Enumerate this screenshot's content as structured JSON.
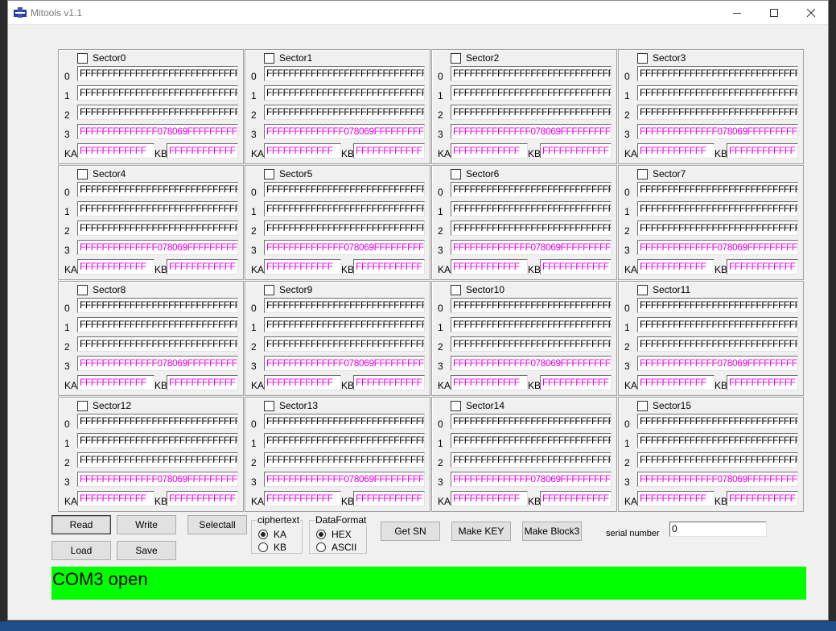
{
  "window": {
    "title": "Mitools v1.1",
    "accent_color": "#3f51b5"
  },
  "labels": {
    "block_rows": [
      "0",
      "1",
      "2",
      "3"
    ],
    "key_a": "KA",
    "key_b": "KB"
  },
  "sectors": [
    {
      "name": "Sector0",
      "checked": false,
      "blocks": [
        "FFFFFFFFFFFFFFFFFFFFFFFFFFFFFFFF",
        "FFFFFFFFFFFFFFFFFFFFFFFFFFFFFFFF",
        "FFFFFFFFFFFFFFFFFFFFFFFFFFFFFFFF",
        "FFFFFFFFFFFFFF078069FFFFFFFFFFFF"
      ],
      "key_a": "FFFFFFFFFFFF",
      "key_b": "FFFFFFFFFFFF"
    },
    {
      "name": "Sector1",
      "checked": false,
      "blocks": [
        "FFFFFFFFFFFFFFFFFFFFFFFFFFFFFFFF",
        "FFFFFFFFFFFFFFFFFFFFFFFFFFFFFFFF",
        "FFFFFFFFFFFFFFFFFFFFFFFFFFFFFFFF",
        "FFFFFFFFFFFFFF078069FFFFFFFFFFFF"
      ],
      "key_a": "FFFFFFFFFFFF",
      "key_b": "FFFFFFFFFFFF"
    },
    {
      "name": "Sector2",
      "checked": false,
      "blocks": [
        "FFFFFFFFFFFFFFFFFFFFFFFFFFFFFFFF",
        "FFFFFFFFFFFFFFFFFFFFFFFFFFFFFFFF",
        "FFFFFFFFFFFFFFFFFFFFFFFFFFFFFFFF",
        "FFFFFFFFFFFFFF078069FFFFFFFFFFFF"
      ],
      "key_a": "FFFFFFFFFFFF",
      "key_b": "FFFFFFFFFFFF"
    },
    {
      "name": "Sector3",
      "checked": false,
      "blocks": [
        "FFFFFFFFFFFFFFFFFFFFFFFFFFFFFFFF",
        "FFFFFFFFFFFFFFFFFFFFFFFFFFFFFFFF",
        "FFFFFFFFFFFFFFFFFFFFFFFFFFFFFFFF",
        "FFFFFFFFFFFFFF078069FFFFFFFFFFFF"
      ],
      "key_a": "FFFFFFFFFFFF",
      "key_b": "FFFFFFFFFFFF"
    },
    {
      "name": "Sector4",
      "checked": false,
      "blocks": [
        "FFFFFFFFFFFFFFFFFFFFFFFFFFFFFFFF",
        "FFFFFFFFFFFFFFFFFFFFFFFFFFFFFFFF",
        "FFFFFFFFFFFFFFFFFFFFFFFFFFFFFFFF",
        "FFFFFFFFFFFFFF078069FFFFFFFFFFFF"
      ],
      "key_a": "FFFFFFFFFFFF",
      "key_b": "FFFFFFFFFFFF"
    },
    {
      "name": "Sector5",
      "checked": false,
      "blocks": [
        "FFFFFFFFFFFFFFFFFFFFFFFFFFFFFFFF",
        "FFFFFFFFFFFFFFFFFFFFFFFFFFFFFFFF",
        "FFFFFFFFFFFFFFFFFFFFFFFFFFFFFFFF",
        "FFFFFFFFFFFFFF078069FFFFFFFFFFFF"
      ],
      "key_a": "FFFFFFFFFFFF",
      "key_b": "FFFFFFFFFFFF"
    },
    {
      "name": "Sector6",
      "checked": false,
      "blocks": [
        "FFFFFFFFFFFFFFFFFFFFFFFFFFFFFFFF",
        "FFFFFFFFFFFFFFFFFFFFFFFFFFFFFFFF",
        "FFFFFFFFFFFFFFFFFFFFFFFFFFFFFFFF",
        "FFFFFFFFFFFFFF078069FFFFFFFFFFFF"
      ],
      "key_a": "FFFFFFFFFFFF",
      "key_b": "FFFFFFFFFFFF"
    },
    {
      "name": "Sector7",
      "checked": false,
      "blocks": [
        "FFFFFFFFFFFFFFFFFFFFFFFFFFFFFFFF",
        "FFFFFFFFFFFFFFFFFFFFFFFFFFFFFFFF",
        "FFFFFFFFFFFFFFFFFFFFFFFFFFFFFFFF",
        "FFFFFFFFFFFFFF078069FFFFFFFFFFFF"
      ],
      "key_a": "FFFFFFFFFFFF",
      "key_b": "FFFFFFFFFFFF"
    },
    {
      "name": "Sector8",
      "checked": false,
      "blocks": [
        "FFFFFFFFFFFFFFFFFFFFFFFFFFFFFFFF",
        "FFFFFFFFFFFFFFFFFFFFFFFFFFFFFFFF",
        "FFFFFFFFFFFFFFFFFFFFFFFFFFFFFFFF",
        "FFFFFFFFFFFFFF078069FFFFFFFFFFFF"
      ],
      "key_a": "FFFFFFFFFFFF",
      "key_b": "FFFFFFFFFFFF"
    },
    {
      "name": "Sector9",
      "checked": false,
      "blocks": [
        "FFFFFFFFFFFFFFFFFFFFFFFFFFFFFFFF",
        "FFFFFFFFFFFFFFFFFFFFFFFFFFFFFFFF",
        "FFFFFFFFFFFFFFFFFFFFFFFFFFFFFFFF",
        "FFFFFFFFFFFFFF078069FFFFFFFFFFFF"
      ],
      "key_a": "FFFFFFFFFFFF",
      "key_b": "FFFFFFFFFFFF"
    },
    {
      "name": "Sector10",
      "checked": false,
      "blocks": [
        "FFFFFFFFFFFFFFFFFFFFFFFFFFFFFFFF",
        "FFFFFFFFFFFFFFFFFFFFFFFFFFFFFFFF",
        "FFFFFFFFFFFFFFFFFFFFFFFFFFFFFFFF",
        "FFFFFFFFFFFFFF078069FFFFFFFFFFFF"
      ],
      "key_a": "FFFFFFFFFFFF",
      "key_b": "FFFFFFFFFFFF"
    },
    {
      "name": "Sector11",
      "checked": false,
      "blocks": [
        "FFFFFFFFFFFFFFFFFFFFFFFFFFFFFFFF",
        "FFFFFFFFFFFFFFFFFFFFFFFFFFFFFFFF",
        "FFFFFFFFFFFFFFFFFFFFFFFFFFFFFFFF",
        "FFFFFFFFFFFFFF078069FFFFFFFFFFFF"
      ],
      "key_a": "FFFFFFFFFFFF",
      "key_b": "FFFFFFFFFFFF"
    },
    {
      "name": "Sector12",
      "checked": false,
      "blocks": [
        "FFFFFFFFFFFFFFFFFFFFFFFFFFFFFFFF",
        "FFFFFFFFFFFFFFFFFFFFFFFFFFFFFFFF",
        "FFFFFFFFFFFFFFFFFFFFFFFFFFFFFFFF",
        "FFFFFFFFFFFFFF078069FFFFFFFFFFFF"
      ],
      "key_a": "FFFFFFFFFFFF",
      "key_b": "FFFFFFFFFFFF"
    },
    {
      "name": "Sector13",
      "checked": false,
      "blocks": [
        "FFFFFFFFFFFFFFFFFFFFFFFFFFFFFFFF",
        "FFFFFFFFFFFFFFFFFFFFFFFFFFFFFFFF",
        "FFFFFFFFFFFFFFFFFFFFFFFFFFFFFFFF",
        "FFFFFFFFFFFFFF078069FFFFFFFFFFFF"
      ],
      "key_a": "FFFFFFFFFFFF",
      "key_b": "FFFFFFFFFFFF"
    },
    {
      "name": "Sector14",
      "checked": false,
      "blocks": [
        "FFFFFFFFFFFFFFFFFFFFFFFFFFFFFFFF",
        "FFFFFFFFFFFFFFFFFFFFFFFFFFFFFFFF",
        "FFFFFFFFFFFFFFFFFFFFFFFFFFFFFFFF",
        "FFFFFFFFFFFFFF078069FFFFFFFFFFFF"
      ],
      "key_a": "FFFFFFFFFFFF",
      "key_b": "FFFFFFFFFFFF"
    },
    {
      "name": "Sector15",
      "checked": false,
      "blocks": [
        "FFFFFFFFFFFFFFFFFFFFFFFFFFFFFFFF",
        "FFFFFFFFFFFFFFFFFFFFFFFFFFFFFFFF",
        "FFFFFFFFFFFFFFFFFFFFFFFFFFFFFFFF",
        "FFFFFFFFFFFFFF078069FFFFFFFFFFFF"
      ],
      "key_a": "FFFFFFFFFFFF",
      "key_b": "FFFFFFFFFFFF"
    }
  ],
  "buttons": {
    "read": "Read",
    "write": "Write",
    "selectall": "Selectall",
    "load": "Load",
    "save": "Save",
    "get_sn": "Get SN",
    "make_key": "Make KEY",
    "make_block3": "Make Block3"
  },
  "ciphertext": {
    "title": "ciphertext",
    "options": [
      "KA",
      "KB"
    ],
    "selected": "KA"
  },
  "data_format": {
    "title": "DataFormat",
    "options": [
      "HEX",
      "ASCII"
    ],
    "selected": "HEX"
  },
  "serial": {
    "label": "serial number",
    "value": "0"
  },
  "status": {
    "text": "COM3 open",
    "color": "#00ff00"
  },
  "colors": {
    "block3_text": "#e800e8",
    "window_bg": "#f0f0f0"
  }
}
